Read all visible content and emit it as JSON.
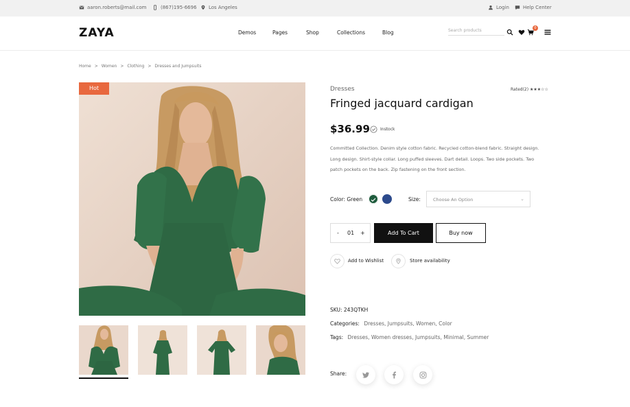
{
  "topbar": {
    "email": "aaron.roberts@mail.com",
    "phone": "(867)195-6696",
    "location": "Los Angeles",
    "login": "Login",
    "help": "Help Center"
  },
  "header": {
    "logo": "ZAYA",
    "nav": [
      "Demos",
      "Pages",
      "Shop",
      "Collections",
      "Blog"
    ],
    "search_placeholder": "Search products",
    "cart_count": "0"
  },
  "breadcrumb": [
    "Home",
    "Women",
    "Clothing",
    "Dresses and Jumpsuits"
  ],
  "product": {
    "badge": "Hot",
    "category": "Dresses",
    "rated": "Rated(2)",
    "stars": "★★★☆☆",
    "title": "Fringed jacquard cardigan",
    "price": "$36.99",
    "stock": "Instock",
    "description": "Committed Collection. Denim style cotton fabric. Recycled cotton-blend fabric. Straight design. Long design. Shirt-style collar. Long puffed sleeves. Dart detail. Loops. Two side pockets. Two patch pockets on the back. Zip fastening on the front section.",
    "color_label": "Color: Green",
    "colors": [
      "#1f5c3d",
      "#2c4a8c"
    ],
    "size_label": "Size:",
    "size_placeholder": "Choose An Option",
    "qty_minus": "-",
    "qty_value": "01",
    "qty_plus": "+",
    "add_to_cart": "Add To Cart",
    "buy_now": "Buy now",
    "wishlist": "Add to Wishlist",
    "store": "Store availability",
    "sku_label": "SKU:",
    "sku": "243QTKH",
    "categories_label": "Categories:",
    "categories": "Dresses, Jumpsuits, Women, Color",
    "tags_label": "Tags:",
    "tags": "Dresses, Women dresses, Jumpsuits, Minimal, Summer",
    "share_label": "Share:"
  },
  "icons": [
    "mail-icon",
    "phone-icon",
    "location-pin-icon",
    "user-icon",
    "chat-icon",
    "search-icon",
    "heart-icon",
    "cart-icon",
    "menu-icon",
    "check-circle-icon",
    "chevron-down-icon",
    "map-pin-icon",
    "twitter-icon",
    "facebook-icon",
    "instagram-icon"
  ]
}
